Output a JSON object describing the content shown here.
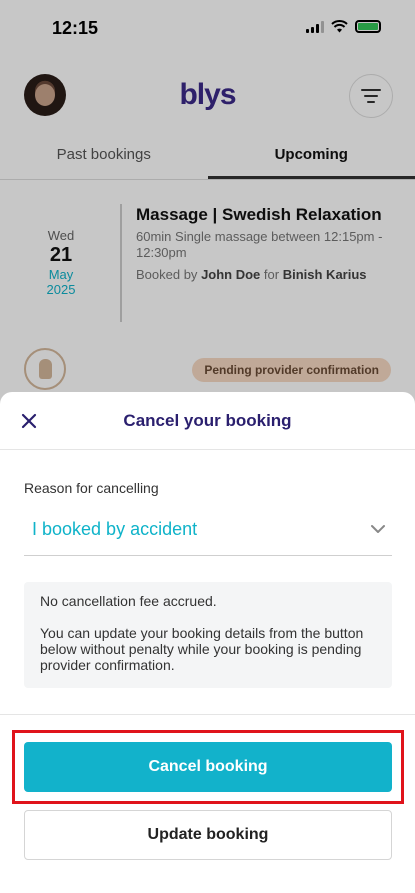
{
  "status_bar": {
    "time": "12:15"
  },
  "header": {
    "logo": "blys"
  },
  "tabs": [
    {
      "label": "Past bookings",
      "active": false
    },
    {
      "label": "Upcoming",
      "active": true
    }
  ],
  "booking": {
    "day_of_week": "Wed",
    "day": "21",
    "month": "May",
    "year": "2025",
    "title": "Massage | Swedish Relaxation",
    "description": "60min Single massage between 12:15pm - 12:30pm",
    "booked_by_prefix": "Booked by",
    "booked_by_name": "John Doe",
    "for_word": "for",
    "recipient": "Binish Karius",
    "status": "Pending provider confirmation"
  },
  "sheet": {
    "title": "Cancel your booking",
    "reason_label": "Reason for cancelling",
    "reason_value": "I booked by accident",
    "info_line1": "No cancellation fee accrued.",
    "info_line2": "You can update your booking details from the button below without penalty while your booking is pending provider confirmation.",
    "cancel_label": "Cancel booking",
    "update_label": "Update booking"
  },
  "colors": {
    "accent": "#12b2cb",
    "brand": "#3b2a88",
    "highlight": "#e0131b",
    "badge": "#f6d9c3"
  }
}
